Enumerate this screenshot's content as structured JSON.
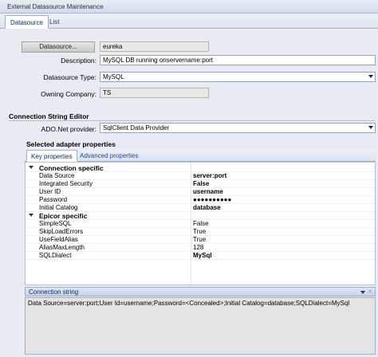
{
  "window": {
    "title": "External Datasource Maintenance"
  },
  "tabs": [
    {
      "label": "Datasource",
      "active": true
    },
    {
      "label": "List",
      "active": false
    }
  ],
  "form": {
    "datasource_button": "Datasource...",
    "datasource_value": "eureka",
    "description_label": "Description:",
    "description_value": "MySQL DB running onservername:port",
    "type_label": "Datasource Type:",
    "type_value": "MySQL",
    "company_label": "Owning Company:",
    "company_value": "TS"
  },
  "connection_editor": {
    "title": "Connection String Editor",
    "provider_label": "ADO.Net provider:",
    "provider_value": "SqlClient Data Provider",
    "adapter_title": "Selected adapter properties",
    "subtabs": [
      {
        "label": "Key properties",
        "active": true
      },
      {
        "label": "Advanced properties",
        "active": false
      }
    ]
  },
  "properties": {
    "connection_specific": {
      "label": "Connection specific",
      "rows": [
        {
          "name": "Data Source",
          "value": "server:port",
          "bold": true
        },
        {
          "name": "Integrated Security",
          "value": "False",
          "bold": true
        },
        {
          "name": "User ID",
          "value": "username",
          "bold": true
        },
        {
          "name": "Password",
          "value": "●●●●●●●●●●",
          "bold": true
        },
        {
          "name": "Initial Catalog",
          "value": "database",
          "bold": true
        }
      ]
    },
    "epicor_specific": {
      "label": "Epicor specific",
      "rows": [
        {
          "name": "SimpleSQL",
          "value": "False",
          "bold": false
        },
        {
          "name": "SkipLoadErrors",
          "value": "True",
          "bold": false
        },
        {
          "name": "UseFieldAlias",
          "value": "True",
          "bold": false
        },
        {
          "name": "AliasMaxLength",
          "value": "128",
          "bold": false
        },
        {
          "name": "SQLDialect",
          "value": "MySql",
          "bold": true
        }
      ]
    }
  },
  "connection_string": {
    "label": "Connection string",
    "value": "Data  Source=server:port;User  Id=username;Password=<Concealed>;Initial  Catalog=database;SQLDialect=MySql"
  },
  "icons": {
    "category_collapse": "triangle-down",
    "dropdown": "chevron-down",
    "pin": "pin-icon"
  }
}
